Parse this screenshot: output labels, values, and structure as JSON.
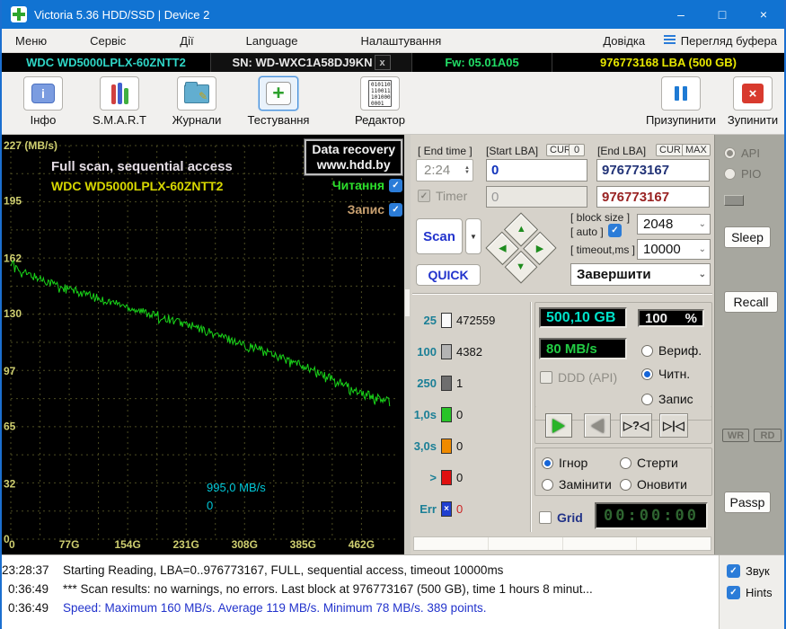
{
  "window": {
    "title": "Victoria 5.36 HDD/SSD | Device 2",
    "minimize": "–",
    "maximize": "□",
    "close": "×"
  },
  "menu": {
    "items": [
      "Меню",
      "Сервіс",
      "Дії",
      "Language",
      "Налаштування",
      "Довідка"
    ],
    "buffer_view": "Перегляд буфера"
  },
  "device_bar": {
    "model": "WDC WD5000LPLX-60ZNTT2",
    "serial": "SN: WD-WXC1A58DJ9KN",
    "close": "x",
    "firmware": "Fw: 05.01A05",
    "capacity": "976773168 LBA (500 GB)"
  },
  "toolbar": {
    "info": "Інфо",
    "smart": "S.M.A.R.T",
    "logs": "Журнали",
    "test": "Тестування",
    "editor": "Редактор",
    "pause": "Призупинити",
    "stop": "Зупинити",
    "editor_icon_text": "010110 110011 101000 0001"
  },
  "chart_data": {
    "type": "line",
    "title": "Full scan, sequential access",
    "subtitle": "WDC WD5000LPLX-60ZNTT2",
    "series_name": "Читання",
    "x_unit": "GB",
    "y_unit": "MB/s",
    "y_top_label": "227 (MB/s)",
    "y_ticks": [
      227,
      195,
      162,
      130,
      97,
      65,
      32,
      0
    ],
    "x_ticks": [
      "0",
      "77G",
      "154G",
      "231G",
      "308G",
      "385G",
      "462G"
    ],
    "x_tick_gb": [
      0,
      77,
      154,
      231,
      308,
      385,
      462
    ],
    "xlim": [
      0,
      500
    ],
    "ylim": [
      0,
      227
    ],
    "grid": true,
    "line_color": "#19d419",
    "points": [
      [
        0,
        160
      ],
      [
        20,
        153
      ],
      [
        40,
        150
      ],
      [
        60,
        147
      ],
      [
        77,
        144
      ],
      [
        100,
        141
      ],
      [
        120,
        138
      ],
      [
        140,
        136
      ],
      [
        154,
        134
      ],
      [
        175,
        131
      ],
      [
        195,
        129
      ],
      [
        215,
        126
      ],
      [
        231,
        124
      ],
      [
        250,
        121
      ],
      [
        270,
        118
      ],
      [
        290,
        115
      ],
      [
        308,
        112
      ],
      [
        325,
        110
      ],
      [
        345,
        107
      ],
      [
        365,
        103
      ],
      [
        385,
        100
      ],
      [
        405,
        96
      ],
      [
        425,
        92
      ],
      [
        445,
        88
      ],
      [
        465,
        84
      ],
      [
        485,
        81
      ],
      [
        500,
        79
      ]
    ],
    "stats": {
      "max_mbs": 160,
      "avg_mbs": 119,
      "min_mbs": 78,
      "points": 389
    }
  },
  "graph": {
    "badge_line1": "Data recovery",
    "badge_line2": "www.hdd.by",
    "legend_read": "Читання",
    "legend_write": "Запис",
    "marker_speed": "995,0 MB/s",
    "marker_lba": "0"
  },
  "test_panel": {
    "end_time_label": "[ End time ]",
    "end_time_value": "2:24",
    "timer_label": "Timer",
    "start_lba_label": "[Start LBA]",
    "cur_label": "CUR",
    "zero_label": "0",
    "end_lba_label": "[End LBA]",
    "max_label": "MAX",
    "start_lba_value": "0",
    "start_lba_value2": "0",
    "end_lba_value": "976773167",
    "end_lba_value2": "976773167",
    "scan_label": "Scan",
    "quick_label": "QUICK",
    "block_size_label": "[ block size ]",
    "auto_label": "[ auto ]",
    "block_size_value": "2048",
    "timeout_label": "[ timeout,ms ]",
    "timeout_value": "10000",
    "action_value": "Завершити",
    "size_display": "500,10 GB",
    "progress_value": "100",
    "progress_unit": "%",
    "speed_display": "80 MB/s",
    "ddd_label": "DDD (API)",
    "mode_verify": "Вериф.",
    "mode_read": "Читн.",
    "mode_write": "Запис",
    "media_verify": "▷?◁",
    "media_edge": "▷|◁",
    "bad_ignore": "Ігнор",
    "bad_erase": "Стерти",
    "bad_remap": "Замінити",
    "bad_refresh": "Оновити",
    "grid_label": "Grid",
    "timer_display": "00:00:00"
  },
  "stats": {
    "rows": [
      {
        "label": "25",
        "count": "472559",
        "color": "#fafafa",
        "count_color": "#111"
      },
      {
        "label": "100",
        "count": "4382",
        "color": "#b4b4b4",
        "count_color": "#111"
      },
      {
        "label": "250",
        "count": "1",
        "color": "#6e6e6e",
        "count_color": "#111"
      },
      {
        "label": "1,0s",
        "count": "0",
        "color": "#28c428",
        "count_color": "#111"
      },
      {
        "label": "3,0s",
        "count": "0",
        "color": "#ef8a00",
        "count_color": "#111"
      },
      {
        "label": ">",
        "count": "0",
        "color": "#e01010",
        "count_color": "#111"
      },
      {
        "label": "Err",
        "count": "0",
        "color": "#1f3fd0",
        "count_color": "#cc2222"
      }
    ],
    "err_mark": "×"
  },
  "right_rail": {
    "api": "API",
    "pio": "PIO",
    "sleep": "Sleep",
    "recall": "Recall",
    "wr": "WR",
    "rd": "RD",
    "passp": "Passp"
  },
  "log": {
    "rows": [
      {
        "time": "23:28:37",
        "text": "Starting Reading, LBA=0..976773167, FULL, sequential access, timeout 10000ms"
      },
      {
        "time": "0:36:49",
        "text": "*** Scan results: no warnings, no errors. Last block at 976773167 (500 GB), time 1 hours 8 minut..."
      },
      {
        "time": "0:36:49",
        "text": "Speed: Maximum 160 MB/s. Average 119 MB/s. Minimum 78 MB/s. 389 points."
      }
    ],
    "sound_label": "Звук",
    "hints_label": "Hints"
  },
  "colors": {
    "titlebar": "#1173d2",
    "accent_blue": "#2b7cd8",
    "graph_bg": "#000000",
    "axis_label": "#cfcf70",
    "grid_line": "#4c4c22",
    "read_line": "#19d419",
    "model_cyan": "#2fd6c6",
    "fw_green": "#22dd66",
    "capacity_yellow": "#e8e800"
  }
}
